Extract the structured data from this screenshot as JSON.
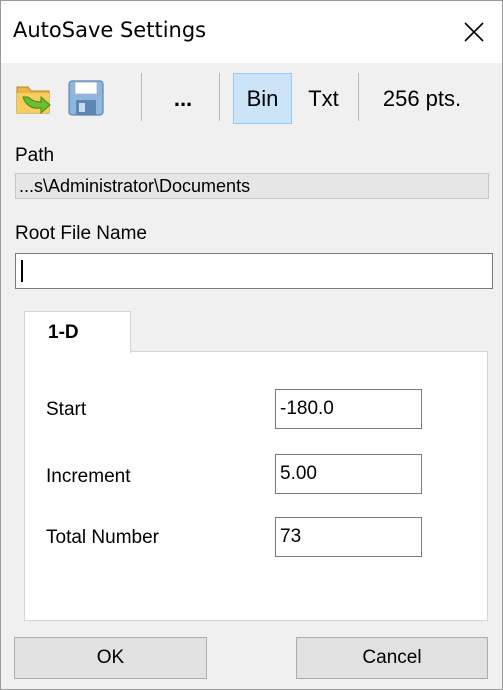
{
  "window": {
    "title": "AutoSave Settings"
  },
  "toolbar": {
    "open_icon": "folder-arrow-icon",
    "save_icon": "floppy-disk-icon",
    "browse_label": "...",
    "bin_label": "Bin",
    "txt_label": "Txt",
    "points_label": "256 pts.",
    "active_format": "Bin"
  },
  "path": {
    "label": "Path",
    "value": "...s\\Administrator\\Documents"
  },
  "root_file": {
    "label": "Root File Name",
    "value": ""
  },
  "tabs": [
    {
      "label": "1-D",
      "selected": true
    }
  ],
  "fields": {
    "start": {
      "label": "Start",
      "value": "-180.0"
    },
    "increment": {
      "label": "Increment",
      "value": "5.00"
    },
    "total": {
      "label": "Total Number",
      "value": "73"
    }
  },
  "buttons": {
    "ok": "OK",
    "cancel": "Cancel"
  },
  "colors": {
    "active_button_bg": "#cce4f7",
    "active_button_border": "#99c9ef"
  }
}
